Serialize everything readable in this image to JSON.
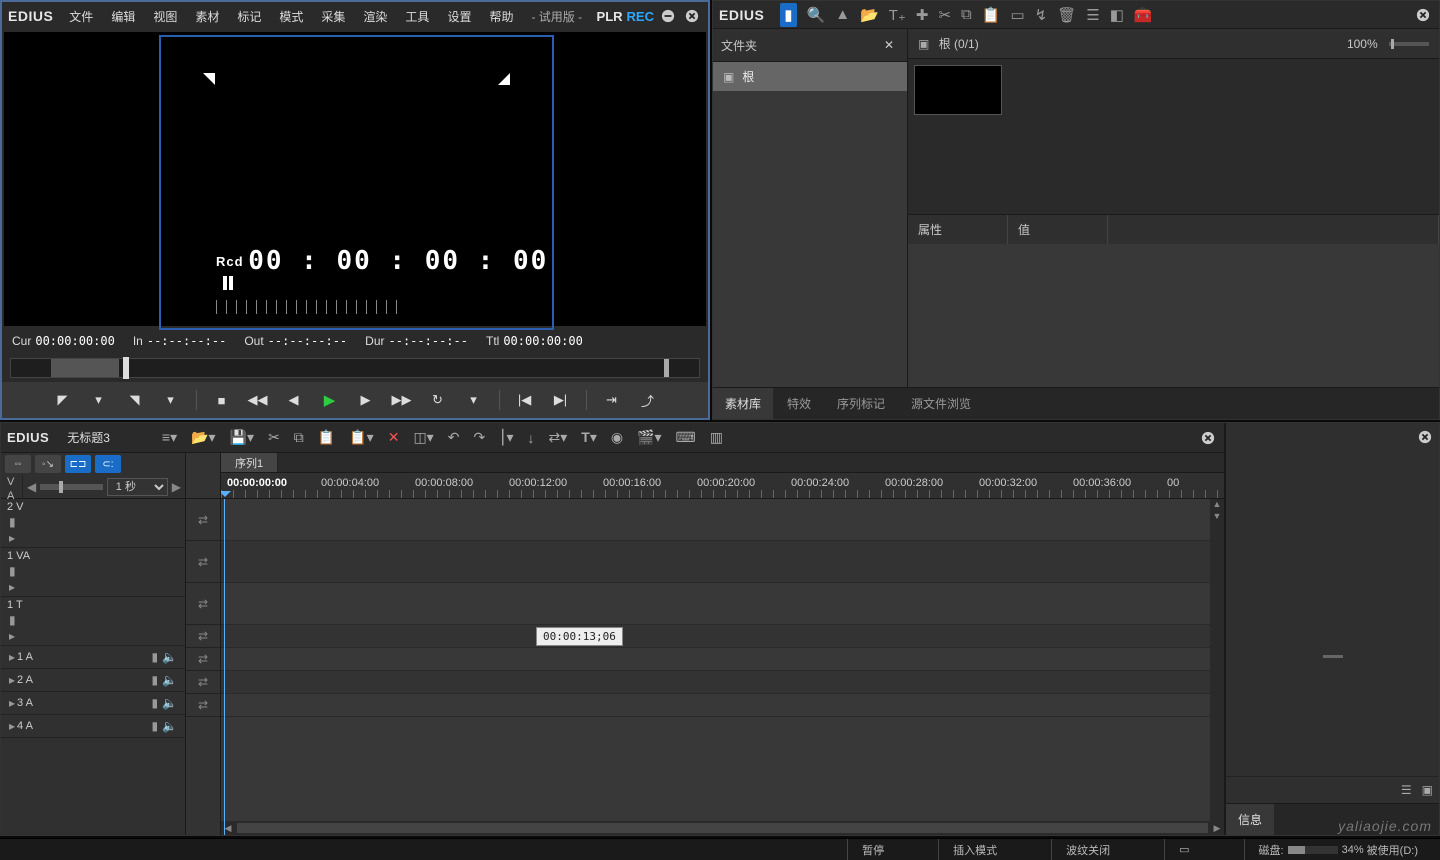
{
  "brand": "EDIUS",
  "menu": [
    "文件",
    "编辑",
    "视图",
    "素材",
    "标记",
    "模式",
    "采集",
    "渲染",
    "工具",
    "设置",
    "帮助",
    "- 试用版 -"
  ],
  "player": {
    "mode_plr": "PLR",
    "mode_rec": "REC",
    "rcd_label": "Rcd",
    "rcd_tc": "00 : 00 : 00 : 00",
    "cur_lbl": "Cur",
    "cur_tc": "00:00:00:00",
    "in_lbl": "In",
    "in_tc": "--:--:--:--",
    "out_lbl": "Out",
    "out_tc": "--:--:--:--",
    "dur_lbl": "Dur",
    "dur_tc": "--:--:--:--",
    "ttl_lbl": "Ttl",
    "ttl_tc": "00:00:00:00"
  },
  "bin": {
    "folder_header": "文件夹",
    "root": "根",
    "root_path": "根  (0/1)",
    "zoom": "100%",
    "prop_h1": "属性",
    "prop_h2": "值",
    "tabs": [
      "素材库",
      "特效",
      "序列标记",
      "源文件浏览"
    ]
  },
  "timeline": {
    "project": "无标题3",
    "sequence": "序列1",
    "zoom_unit": "1 秒",
    "cursor_tc": "00:00:00:00",
    "ruler": [
      "00:00:00:00",
      "00:00:04:00",
      "00:00:08:00",
      "00:00:12:00",
      "00:00:16:00",
      "00:00:20:00",
      "00:00:24:00",
      "00:00:28:00",
      "00:00:32:00",
      "00:00:36:00",
      "00"
    ],
    "tracks_v": "V",
    "tracks_a": "A",
    "tracks": [
      {
        "label": "2 V",
        "tall": true
      },
      {
        "label": "1 VA",
        "tall": true
      },
      {
        "label": "1 T",
        "tall": true
      },
      {
        "label": "1 A",
        "tall": false
      },
      {
        "label": "2 A",
        "tall": false
      },
      {
        "label": "3 A",
        "tall": false
      },
      {
        "label": "4 A",
        "tall": false
      }
    ],
    "tooltip": "00:00:13;06",
    "info_tab": "信息"
  },
  "status": {
    "pause": "暂停",
    "insert": "插入模式",
    "ripple": "波纹关闭",
    "disk": "磁盘:",
    "disk_pct": "34%",
    "disk_used": "被使用(D:)"
  },
  "watermark": "yaliaojie.com"
}
